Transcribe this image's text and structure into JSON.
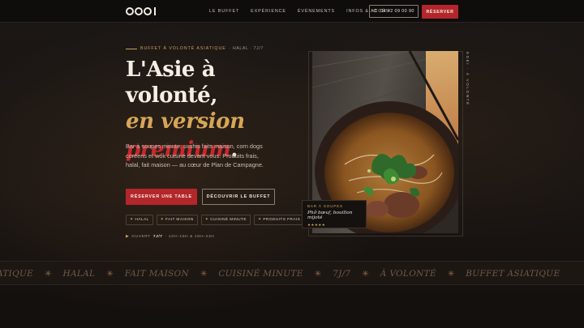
{
  "nav": {
    "links": [
      "LE BUFFET",
      "EXPÉRIENCE",
      "ÉVÉNEMENTS",
      "INFOS & ACCÈS"
    ],
    "phone": "04 42 09 00 90",
    "reserve": "RÉSERVER"
  },
  "hero": {
    "eyebrow": "BUFFET À VOLONTÉ ASIATIQUE",
    "eyebrow_sub": "· HALAL · 7J/7",
    "title_line1": "L'Asie à volonté,",
    "title_line2": "en version",
    "title_line3": "premium",
    "title_dot": ".",
    "description": "Bar à soupes minute, sushis faits maison, corn dogs coréens et wok cuisiné devant vous. Produits frais, halal, fait maison — au cœur de Plan de Campagne.",
    "cta_primary": "RÉSERVER UNE TABLE",
    "cta_secondary": "DÉCOUVRIR LE BUFFET",
    "tags": [
      "HALAL",
      "FAIT MAISON",
      "CUISINÉ MINUTE",
      "PRODUITS FRAIS"
    ],
    "hours_prefix": "OUVERT",
    "hours_days": "7J/7",
    "hours_times": "· 12H–15H & 19H–23H"
  },
  "side": {
    "vertical_label": "EDEI · À VOLONTÉ",
    "dish_category": "BAR À SOUPES",
    "dish_name": "Phở bœuf, bouillon mijoté",
    "dish_stars": "★★★★★"
  },
  "marquee": [
    "BUFFET ASIATIQUE",
    "HALAL",
    "FAIT MAISON",
    "CUISINÉ MINUTE",
    "7J/7",
    "À VOLONTÉ",
    "BUFFET ASIATIQUE"
  ],
  "colors": {
    "accent_red": "#b3262a",
    "accent_gold": "#d6a658",
    "background": "#141110"
  },
  "icons": {
    "phone": "phone-icon",
    "logo": "edei-logo"
  }
}
